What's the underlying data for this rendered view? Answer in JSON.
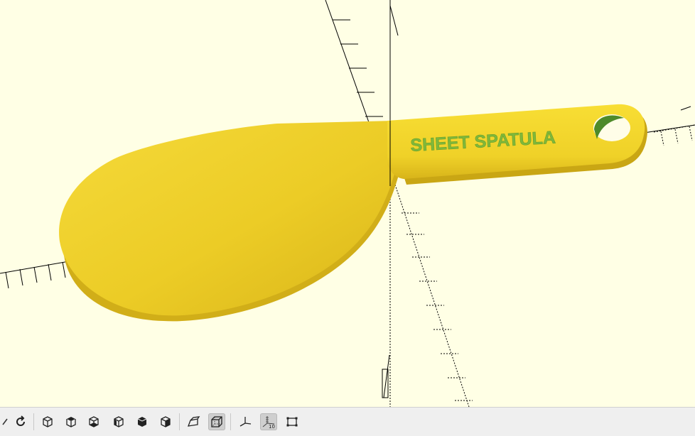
{
  "app": "OpenSCAD",
  "viewport": {
    "background_color": "#ffffe5",
    "model": {
      "name": "sheet-spatula",
      "color": "#f5d32a",
      "shade_color": "#e0bc1c",
      "engraved_text": "SHEET SPATULA",
      "engraved_text_color": "#7fb83a"
    },
    "axes": {
      "visible": true,
      "scale_markers": true
    }
  },
  "toolbar": {
    "buttons": [
      {
        "name": "reset-view-button",
        "icon": "reset-view-icon",
        "active": false
      },
      {
        "name": "view-perspective-button",
        "icon": "view-iso-icon",
        "active": false
      },
      {
        "name": "view-top-button",
        "icon": "view-top-icon",
        "active": false
      },
      {
        "name": "view-bottom-button",
        "icon": "view-bottom-icon",
        "active": false
      },
      {
        "name": "view-left-button",
        "icon": "view-left-icon",
        "active": false
      },
      {
        "name": "view-right-button",
        "icon": "view-right-icon",
        "active": false
      },
      {
        "name": "view-front-button",
        "icon": "view-front-icon",
        "active": false
      },
      {
        "name": "view-back-button",
        "icon": "view-back-icon",
        "active": false
      },
      {
        "name": "perspective-button",
        "icon": "perspective-icon",
        "active": false
      },
      {
        "name": "orthogonal-button",
        "icon": "orthogonal-icon",
        "active": true
      },
      {
        "name": "show-axes-button",
        "icon": "axes-icon",
        "active": false
      },
      {
        "name": "show-scale-button",
        "icon": "scale-markers-icon",
        "active": true
      },
      {
        "name": "show-edges-button",
        "icon": "edges-icon",
        "active": false
      }
    ],
    "scale_icon_label": "10"
  }
}
